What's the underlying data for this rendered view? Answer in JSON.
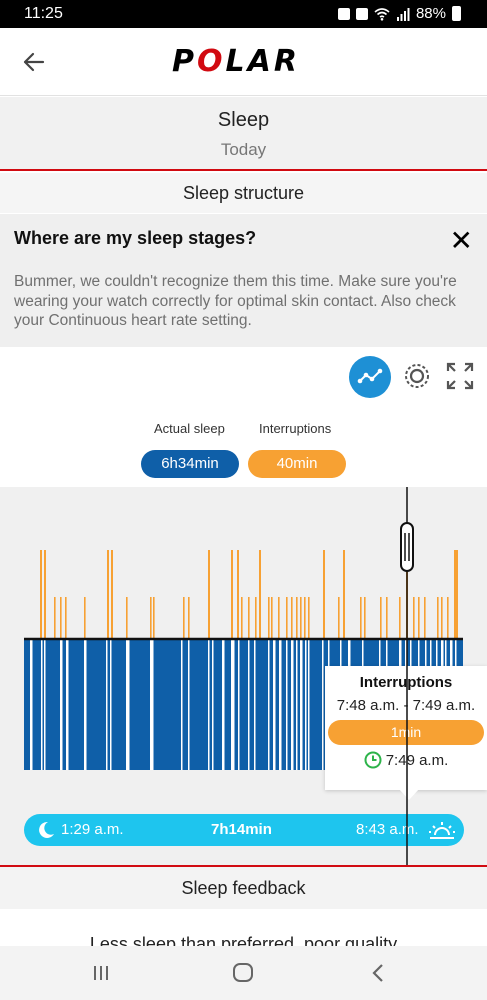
{
  "status": {
    "time": "11:25",
    "battery": "88%"
  },
  "app": {
    "logo": "POLAR"
  },
  "page": {
    "title": "Sleep",
    "date": "Today"
  },
  "sleep_structure": {
    "heading": "Sleep structure"
  },
  "notice": {
    "question": "Where are my sleep stages?",
    "close_glyph": "✕",
    "message": "Bummer, we couldn't recognize them this time. Make sure you're wearing your watch correctly for optimal skin contact. Also check your Continuous heart rate setting."
  },
  "view_toggle": {
    "icons": [
      "trend-chart-icon",
      "circular-view-icon",
      "fullscreen-icon"
    ]
  },
  "legend": {
    "actual_sleep_label": "Actual sleep",
    "actual_sleep_value": "6h34min",
    "interruptions_label": "Interruptions",
    "interruptions_value": "40min"
  },
  "colors": {
    "accent_red": "#d10a11",
    "sleep_blue": "#0f5fa8",
    "interruption_orange": "#f7a133",
    "timeline_cyan": "#1ec5ee",
    "toggle_blue": "#1e90d5"
  },
  "tooltip": {
    "title": "Interruptions",
    "range": "7:48 a.m. - 7:49 a.m.",
    "duration": "1min",
    "time": "7:49 a.m."
  },
  "timeline": {
    "start": "1:29 a.m.",
    "duration": "7h14min",
    "end": "8:43 a.m."
  },
  "sleep_feedback": {
    "heading": "Sleep feedback",
    "partial_text": "Less sleep than preferred, poor quality"
  }
}
